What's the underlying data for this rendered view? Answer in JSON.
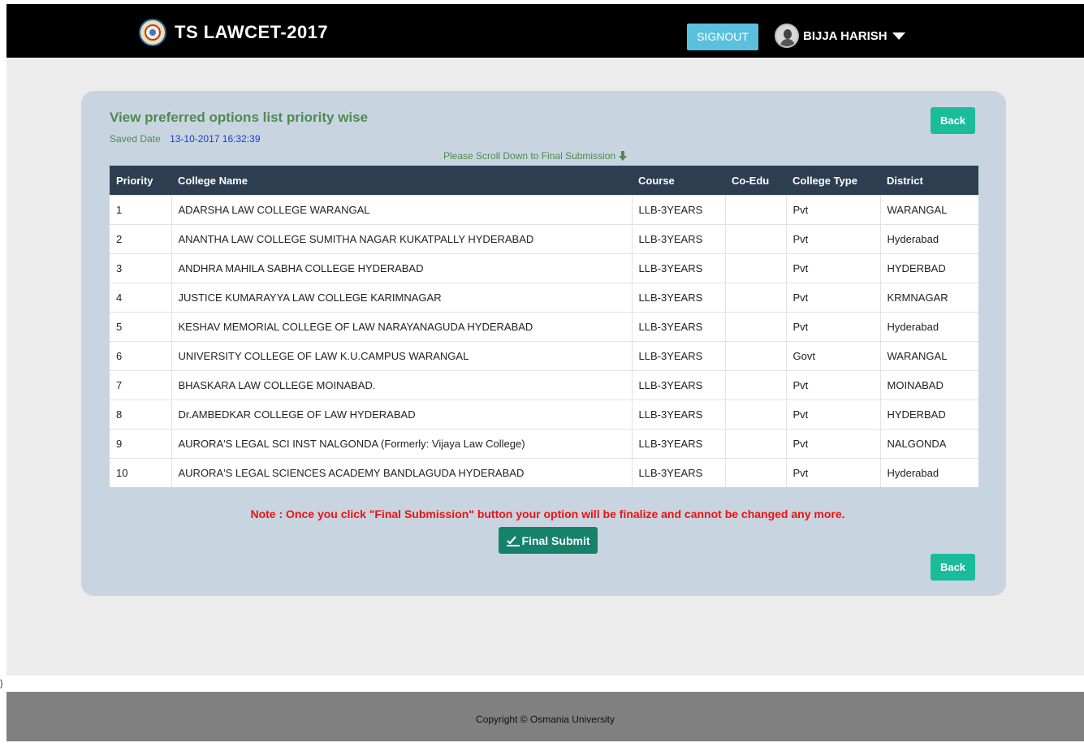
{
  "header": {
    "title": "TS LAWCET-2017",
    "signout_label": "SIGNOUT",
    "user_name": "BIJJA HARISH"
  },
  "panel": {
    "title": "View preferred options list priority wise",
    "saved_date_label": "Saved Date",
    "saved_date_value": "13-10-2017 16:32:39",
    "back_label": "Back",
    "scroll_note": "Please Scroll Down to Final Submission",
    "note": "Note : Once you click \"Final Submission\" button your option will be finalize and cannot be changed any more.",
    "final_submit_label": "Final Submit"
  },
  "table": {
    "headers": [
      "Priority",
      "College Name",
      "Course",
      "Co-Edu",
      "College Type",
      "District"
    ],
    "rows": [
      {
        "priority": "1",
        "college": "ADARSHA LAW COLLEGE WARANGAL",
        "course": "LLB-3YEARS",
        "coedu": "",
        "type": "Pvt",
        "district": "WARANGAL"
      },
      {
        "priority": "2",
        "college": "ANANTHA LAW COLLEGE SUMITHA NAGAR KUKATPALLY HYDERABAD",
        "course": "LLB-3YEARS",
        "coedu": "",
        "type": "Pvt",
        "district": "Hyderabad"
      },
      {
        "priority": "3",
        "college": "ANDHRA MAHILA SABHA COLLEGE HYDERABAD",
        "course": "LLB-3YEARS",
        "coedu": "",
        "type": "Pvt",
        "district": "HYDERBAD"
      },
      {
        "priority": "4",
        "college": "JUSTICE KUMARAYYA LAW COLLEGE KARIMNAGAR",
        "course": "LLB-3YEARS",
        "coedu": "",
        "type": "Pvt",
        "district": "KRMNAGAR"
      },
      {
        "priority": "5",
        "college": "KESHAV MEMORIAL COLLEGE OF LAW NARAYANAGUDA HYDERABAD",
        "course": "LLB-3YEARS",
        "coedu": "",
        "type": "Pvt",
        "district": "Hyderabad"
      },
      {
        "priority": "6",
        "college": "UNIVERSITY COLLEGE OF LAW K.U.CAMPUS WARANGAL",
        "course": "LLB-3YEARS",
        "coedu": "",
        "type": "Govt",
        "district": "WARANGAL"
      },
      {
        "priority": "7",
        "college": "BHASKARA LAW COLLEGE MOINABAD.",
        "course": "LLB-3YEARS",
        "coedu": "",
        "type": "Pvt",
        "district": "MOINABAD"
      },
      {
        "priority": "8",
        "college": "Dr.AMBEDKAR COLLEGE OF LAW HYDERABAD",
        "course": "LLB-3YEARS",
        "coedu": "",
        "type": "Pvt",
        "district": "HYDERBAD"
      },
      {
        "priority": "9",
        "college": "AURORA'S LEGAL SCI INST NALGONDA (Formerly: Vijaya Law College)",
        "course": "LLB-3YEARS",
        "coedu": "",
        "type": "Pvt",
        "district": "NALGONDA"
      },
      {
        "priority": "10",
        "college": "AURORA'S LEGAL SCIENCES ACADEMY BANDLAGUDA HYDERABAD",
        "course": "LLB-3YEARS",
        "coedu": "",
        "type": "Pvt",
        "district": "Hyderabad"
      }
    ]
  },
  "footer": {
    "text": "Copyright © Osmania University"
  },
  "stray_text": "}",
  "icons": {
    "logo": "university-seal-icon",
    "avatar": "user-avatar-icon",
    "caret": "caret-down-icon",
    "scroll": "arrow-down-icon",
    "submit": "check-pen-icon"
  },
  "colors": {
    "navbar": "#000000",
    "signout": "#5bc0de",
    "back": "#1abc9c",
    "final_submit": "#16826a",
    "panel": "#c8d5e1",
    "table_header": "#2c3e50",
    "title_green": "#4f8a4f",
    "date_blue": "#1a3ad8",
    "note_red": "#ee1111"
  }
}
